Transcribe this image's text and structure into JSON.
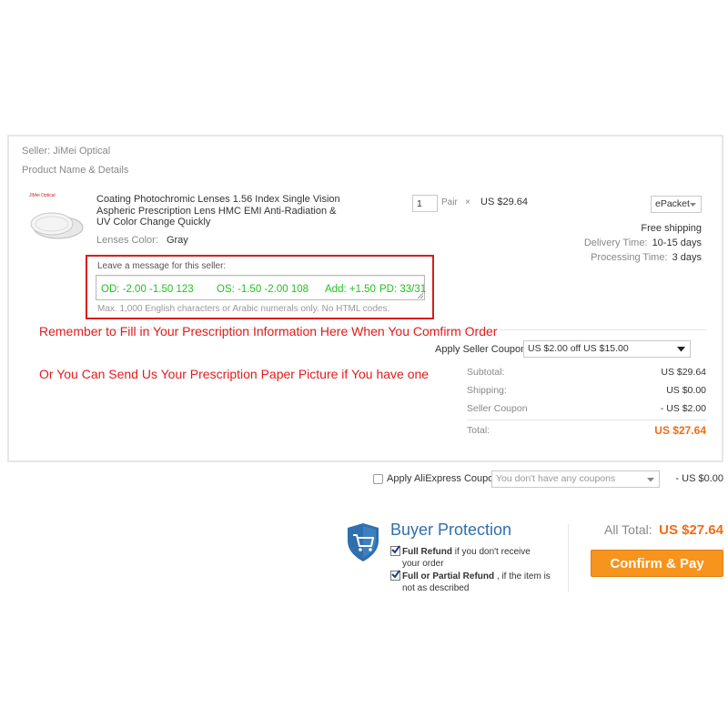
{
  "seller": {
    "label": "Seller: JiMei Optical"
  },
  "product_header": "Product Name & Details",
  "product": {
    "brand_mark": "JiMei Optical",
    "title_line1": "Coating Photochromic Lenses 1.56 Index Single Vision",
    "title_line2": "Aspheric Prescription Lens HMC EMI Anti-Radiation &",
    "title_line3": "UV Color Change Quickly",
    "lens_color_label": "Lenses Color:",
    "lens_color_value": "Gray",
    "quantity": "1",
    "unit": "Pair",
    "times": "×",
    "price": "US $29.64"
  },
  "shipping": {
    "method": "ePacket",
    "free_shipping": "Free shipping",
    "delivery_label": "Delivery Time:",
    "delivery_value": "10-15 days",
    "processing_label": "Processing Time:",
    "processing_value": "3 days"
  },
  "message": {
    "label": "Leave a message for this seller:",
    "od": "OD: -2.00  -1.50  123",
    "os": "OS: -1.50  -2.00   108",
    "add": "Add: +1.50",
    "pd": "PD: 33/31",
    "hint": "Max. 1,000 English characters or Arabic numerals only. No HTML codes."
  },
  "notes": {
    "line1": "Remember to Fill in Your Prescription Information Here When You Comfirm Order",
    "line2": "Or You Can Send Us Your Prescription Paper Picture if You have one"
  },
  "seller_coupon": {
    "label": "Apply Seller Coupon:",
    "value": "US $2.00 off US $15.00"
  },
  "summary": {
    "subtotal_label": "Subtotal:",
    "subtotal_value": "US $29.64",
    "shipping_label": "Shipping:",
    "shipping_value": "US $0.00",
    "coupon_label": "Seller Coupon",
    "coupon_value": "- US $2.00",
    "total_label": "Total:",
    "total_value": "US $27.64"
  },
  "aliexpress_coupon": {
    "label": "Apply AliExpress Coupon:",
    "placeholder": "You don't have any coupons",
    "value": "- US $0.00"
  },
  "buyer_protection": {
    "title": "Buyer Protection",
    "item1_bold": "Full Refund",
    "item1_rest": " if you don't receive",
    "item1_line2": "your order",
    "item2_bold": "Full or Partial Refund",
    "item2_rest": " , if the item is",
    "item2_line2": "not as described"
  },
  "checkout": {
    "all_total_label": "All Total:",
    "all_total_value": "US $27.64",
    "confirm_label": "Confirm & Pay"
  },
  "colors": {
    "accent_orange": "#f26c12",
    "button_orange": "#f7941d",
    "note_red": "#e31b1b",
    "rx_green": "#22c022",
    "protection_blue": "#2f6fad"
  }
}
